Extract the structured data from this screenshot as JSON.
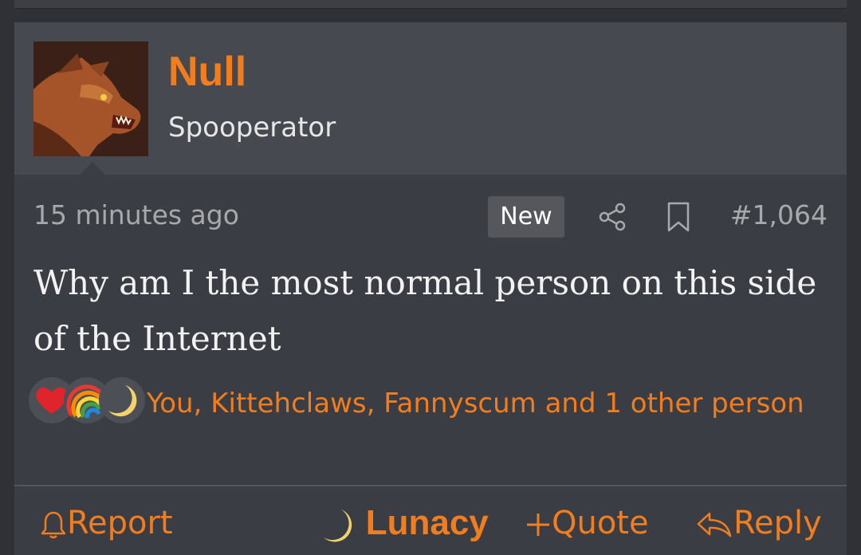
{
  "post": {
    "username": "Null",
    "user_title": "Spooperator",
    "timestamp": "15 minutes ago",
    "new_badge": "New",
    "post_number": "#1,064",
    "message": "Why am I the most normal person on this side of the Internet",
    "reactions": {
      "icons": [
        "heart-icon",
        "rainbow-icon",
        "crescent-moon-icon"
      ],
      "text": "You, Kittehclaws, Fannyscum and 1 other person"
    }
  },
  "actions": {
    "report": "Report",
    "lunacy": "Lunacy",
    "quote": "Quote",
    "reply": "Reply"
  },
  "colors": {
    "accent": "#f07d1e",
    "background": "#3b3d44",
    "header_background": "#474950"
  }
}
